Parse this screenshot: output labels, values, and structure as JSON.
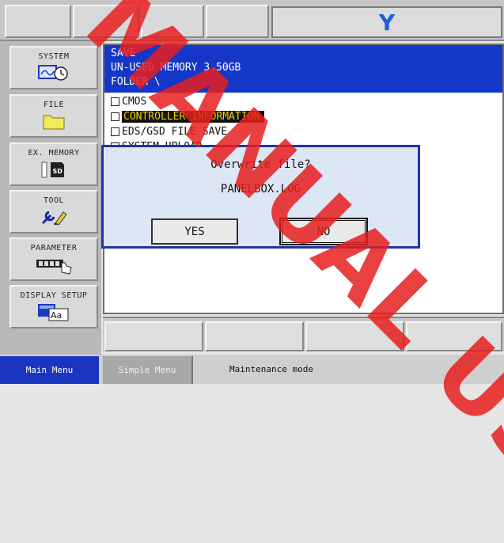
{
  "top": {
    "mode_letter": "Y"
  },
  "menu": {
    "items": [
      {
        "label": "SYSTEM",
        "icon": "system-clock-icon"
      },
      {
        "label": "FILE",
        "icon": "folder-icon"
      },
      {
        "label": "EX. MEMORY",
        "icon": "sd-card-icon"
      },
      {
        "label": "TOOL",
        "icon": "tools-icon"
      },
      {
        "label": "PARAMETER",
        "icon": "parameter-hand-icon"
      },
      {
        "label": "DISPLAY SETUP",
        "icon": "display-setup-icon"
      }
    ]
  },
  "screen": {
    "title": "SAVE",
    "memory": "UN-USED MEMORY  3.50GB",
    "folder": "FOLDER \\",
    "items": [
      "CMOS",
      "CONTROLLER INFORMATION",
      "EDS/GSD FILE SAVE",
      "SYSTEM UPLOAD"
    ]
  },
  "dialog": {
    "question": "Overwrite file?",
    "filename": "PANELBOX.LOG",
    "yes": "YES",
    "no": "NO"
  },
  "status": {
    "main_menu": "Main Menu",
    "simple_menu": "Simple Menu",
    "mode": "Maintenance mode"
  },
  "watermark": "MANUAL USE",
  "colors": {
    "accent": "#1537c8",
    "highlight_text": "#f0d000",
    "watermark": "#e61e1e"
  }
}
